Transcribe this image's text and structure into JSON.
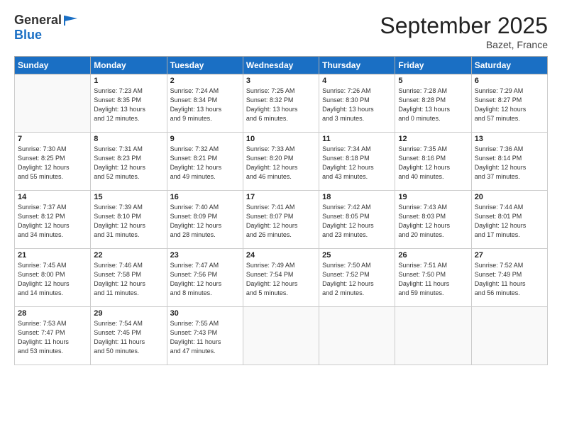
{
  "header": {
    "logo_general": "General",
    "logo_blue": "Blue",
    "title": "September 2025",
    "location": "Bazet, France"
  },
  "days_of_week": [
    "Sunday",
    "Monday",
    "Tuesday",
    "Wednesday",
    "Thursday",
    "Friday",
    "Saturday"
  ],
  "weeks": [
    [
      {
        "num": "",
        "info": ""
      },
      {
        "num": "1",
        "info": "Sunrise: 7:23 AM\nSunset: 8:35 PM\nDaylight: 13 hours\nand 12 minutes."
      },
      {
        "num": "2",
        "info": "Sunrise: 7:24 AM\nSunset: 8:34 PM\nDaylight: 13 hours\nand 9 minutes."
      },
      {
        "num": "3",
        "info": "Sunrise: 7:25 AM\nSunset: 8:32 PM\nDaylight: 13 hours\nand 6 minutes."
      },
      {
        "num": "4",
        "info": "Sunrise: 7:26 AM\nSunset: 8:30 PM\nDaylight: 13 hours\nand 3 minutes."
      },
      {
        "num": "5",
        "info": "Sunrise: 7:28 AM\nSunset: 8:28 PM\nDaylight: 13 hours\nand 0 minutes."
      },
      {
        "num": "6",
        "info": "Sunrise: 7:29 AM\nSunset: 8:27 PM\nDaylight: 12 hours\nand 57 minutes."
      }
    ],
    [
      {
        "num": "7",
        "info": "Sunrise: 7:30 AM\nSunset: 8:25 PM\nDaylight: 12 hours\nand 55 minutes."
      },
      {
        "num": "8",
        "info": "Sunrise: 7:31 AM\nSunset: 8:23 PM\nDaylight: 12 hours\nand 52 minutes."
      },
      {
        "num": "9",
        "info": "Sunrise: 7:32 AM\nSunset: 8:21 PM\nDaylight: 12 hours\nand 49 minutes."
      },
      {
        "num": "10",
        "info": "Sunrise: 7:33 AM\nSunset: 8:20 PM\nDaylight: 12 hours\nand 46 minutes."
      },
      {
        "num": "11",
        "info": "Sunrise: 7:34 AM\nSunset: 8:18 PM\nDaylight: 12 hours\nand 43 minutes."
      },
      {
        "num": "12",
        "info": "Sunrise: 7:35 AM\nSunset: 8:16 PM\nDaylight: 12 hours\nand 40 minutes."
      },
      {
        "num": "13",
        "info": "Sunrise: 7:36 AM\nSunset: 8:14 PM\nDaylight: 12 hours\nand 37 minutes."
      }
    ],
    [
      {
        "num": "14",
        "info": "Sunrise: 7:37 AM\nSunset: 8:12 PM\nDaylight: 12 hours\nand 34 minutes."
      },
      {
        "num": "15",
        "info": "Sunrise: 7:39 AM\nSunset: 8:10 PM\nDaylight: 12 hours\nand 31 minutes."
      },
      {
        "num": "16",
        "info": "Sunrise: 7:40 AM\nSunset: 8:09 PM\nDaylight: 12 hours\nand 28 minutes."
      },
      {
        "num": "17",
        "info": "Sunrise: 7:41 AM\nSunset: 8:07 PM\nDaylight: 12 hours\nand 26 minutes."
      },
      {
        "num": "18",
        "info": "Sunrise: 7:42 AM\nSunset: 8:05 PM\nDaylight: 12 hours\nand 23 minutes."
      },
      {
        "num": "19",
        "info": "Sunrise: 7:43 AM\nSunset: 8:03 PM\nDaylight: 12 hours\nand 20 minutes."
      },
      {
        "num": "20",
        "info": "Sunrise: 7:44 AM\nSunset: 8:01 PM\nDaylight: 12 hours\nand 17 minutes."
      }
    ],
    [
      {
        "num": "21",
        "info": "Sunrise: 7:45 AM\nSunset: 8:00 PM\nDaylight: 12 hours\nand 14 minutes."
      },
      {
        "num": "22",
        "info": "Sunrise: 7:46 AM\nSunset: 7:58 PM\nDaylight: 12 hours\nand 11 minutes."
      },
      {
        "num": "23",
        "info": "Sunrise: 7:47 AM\nSunset: 7:56 PM\nDaylight: 12 hours\nand 8 minutes."
      },
      {
        "num": "24",
        "info": "Sunrise: 7:49 AM\nSunset: 7:54 PM\nDaylight: 12 hours\nand 5 minutes."
      },
      {
        "num": "25",
        "info": "Sunrise: 7:50 AM\nSunset: 7:52 PM\nDaylight: 12 hours\nand 2 minutes."
      },
      {
        "num": "26",
        "info": "Sunrise: 7:51 AM\nSunset: 7:50 PM\nDaylight: 11 hours\nand 59 minutes."
      },
      {
        "num": "27",
        "info": "Sunrise: 7:52 AM\nSunset: 7:49 PM\nDaylight: 11 hours\nand 56 minutes."
      }
    ],
    [
      {
        "num": "28",
        "info": "Sunrise: 7:53 AM\nSunset: 7:47 PM\nDaylight: 11 hours\nand 53 minutes."
      },
      {
        "num": "29",
        "info": "Sunrise: 7:54 AM\nSunset: 7:45 PM\nDaylight: 11 hours\nand 50 minutes."
      },
      {
        "num": "30",
        "info": "Sunrise: 7:55 AM\nSunset: 7:43 PM\nDaylight: 11 hours\nand 47 minutes."
      },
      {
        "num": "",
        "info": ""
      },
      {
        "num": "",
        "info": ""
      },
      {
        "num": "",
        "info": ""
      },
      {
        "num": "",
        "info": ""
      }
    ]
  ]
}
